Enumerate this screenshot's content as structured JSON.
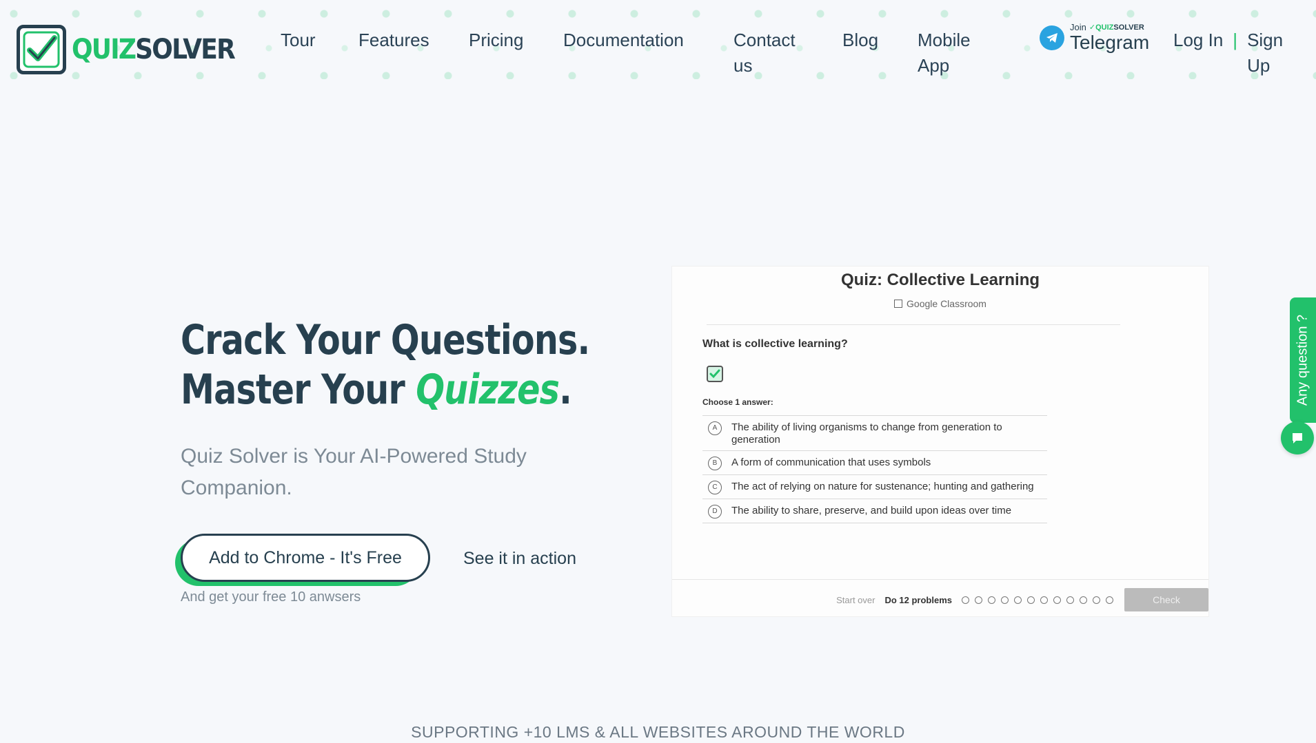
{
  "brand": {
    "quiz": "QUIZ",
    "solver": "SOLVER"
  },
  "nav": {
    "items": [
      {
        "label": "Tour"
      },
      {
        "label": "Features"
      },
      {
        "label": "Pricing"
      },
      {
        "label": "Documentation"
      },
      {
        "label": "Contact\nus"
      },
      {
        "label": "Blog"
      },
      {
        "label": "Mobile\nApp"
      }
    ],
    "telegram": {
      "join": "Join",
      "mini_quiz": "QUIZ",
      "mini_solver": "SOLVER",
      "name": "Telegram"
    },
    "login": "Log In",
    "separator": "|",
    "signup": "Sign\nUp"
  },
  "hero": {
    "title_line1": "Crack Your Questions.",
    "title_line2_prefix": "Master Your ",
    "title_line2_accent": "Quizzes",
    "title_line2_suffix": ".",
    "subtitle": "Quiz Solver is Your AI-Powered Study Companion.",
    "cta_primary": "Add to Chrome - It's Free",
    "cta_secondary": "See it in action",
    "free_note": "And get your free 10 anwsers"
  },
  "quiz_preview": {
    "title": "Quiz: Collective Learning",
    "source": "Google Classroom",
    "question": "What is collective learning?",
    "choose": "Choose 1 answer:",
    "answers": [
      {
        "letter": "A",
        "text": "The ability of living organisms to change from generation to generation"
      },
      {
        "letter": "B",
        "text": "A form of communication that uses symbols"
      },
      {
        "letter": "C",
        "text": "The act of relying on nature for sustenance; hunting and gathering"
      },
      {
        "letter": "D",
        "text": "The ability to share, preserve, and build upon ideas over time"
      }
    ],
    "start_over": "Start over",
    "do_problems": "Do 12 problems",
    "check": "Check"
  },
  "support_text": "SUPPORTING +10 LMS & ALL WEBSITES AROUND THE WORLD",
  "side_tab": "Any question ?",
  "colors": {
    "accent": "#22c16b",
    "dark": "#27404f",
    "telegram": "#2aa3e0"
  }
}
